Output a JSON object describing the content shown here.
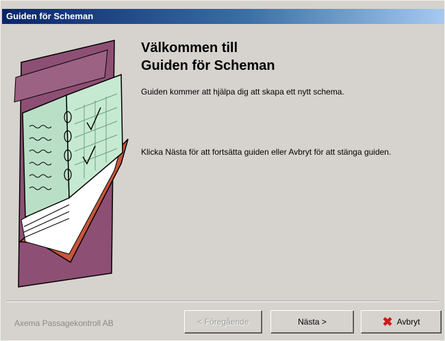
{
  "window": {
    "title": "Guiden för Scheman"
  },
  "welcome": {
    "heading_line1": "Välkommen till",
    "heading_line2": "Guiden för Scheman",
    "intro": "Guiden kommer att hjälpa dig att skapa ett nytt schema.",
    "instructions": "Klicka Nästa för att fortsätta guiden eller Avbryt för att stänga guiden."
  },
  "footer": {
    "company": "Axema Passagekontroll AB",
    "back_label": "< Föregående",
    "next_label": "Nästa >",
    "cancel_label": "Avbryt"
  },
  "icons": {
    "cancel": "red-x-icon",
    "wizard": "notebook-schedule-illustration"
  }
}
